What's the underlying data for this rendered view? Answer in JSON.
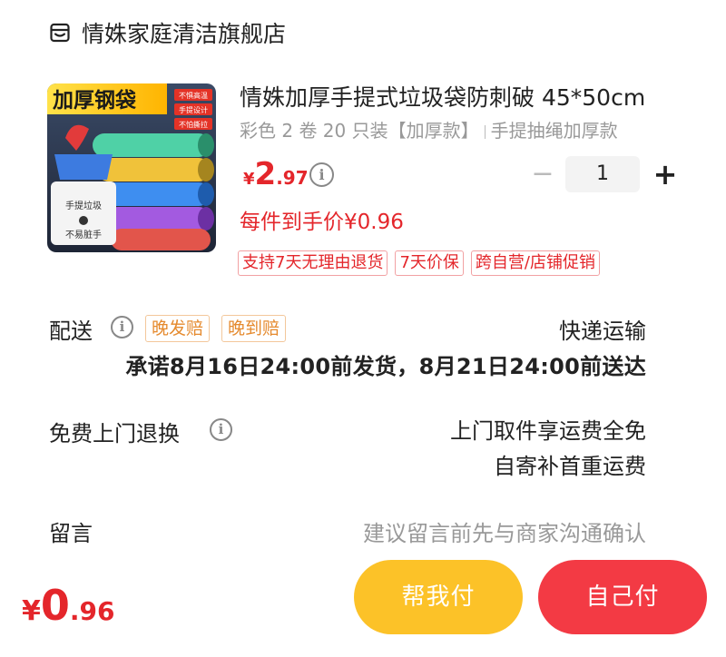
{
  "shop": {
    "name": "情姝家庭清洁旗舰店",
    "icon": "shop-icon"
  },
  "product": {
    "title": "情姝加厚手提式垃圾袋防刺破 45*50cm",
    "spec_part1": "彩色 2 卷 20 只装【加厚款】",
    "spec_part2": "手提抽绳加厚款",
    "image_text": {
      "banner": "加厚钢袋",
      "badges": [
        "不惧高温",
        "手提设计",
        "不怕撕拉"
      ],
      "bin_label_1": "手提垃圾",
      "bin_label_2": "不易脏手"
    },
    "price": {
      "symbol": "¥",
      "int": "2",
      "dec": ".97"
    },
    "quantity": "1",
    "per_item_price": "每件到手价¥0.96",
    "tags": [
      "支持7天无理由退货",
      "7天价保",
      "跨自营/店铺促销"
    ]
  },
  "shipping": {
    "label": "配送",
    "tags": [
      "晚发赔",
      "晚到赔"
    ],
    "method": "快递运输",
    "promise": "承诺8月16日24:00前发货，8月21日24:00前送达"
  },
  "returns": {
    "label": "免费上门退换",
    "line1": "上门取件享运费全免",
    "line2": "自寄补首重运费"
  },
  "message": {
    "label": "留言",
    "placeholder": "建议留言前先与商家沟通确认"
  },
  "footer": {
    "total": {
      "symbol": "¥",
      "int": "0",
      "dec": ".96"
    },
    "help_pay": "帮我付",
    "self_pay": "自己付"
  },
  "colors": {
    "accent_red": "#e4262b",
    "help_button": "#fcc228",
    "self_button": "#f33a44",
    "tag_orange": "#e58a2e"
  }
}
